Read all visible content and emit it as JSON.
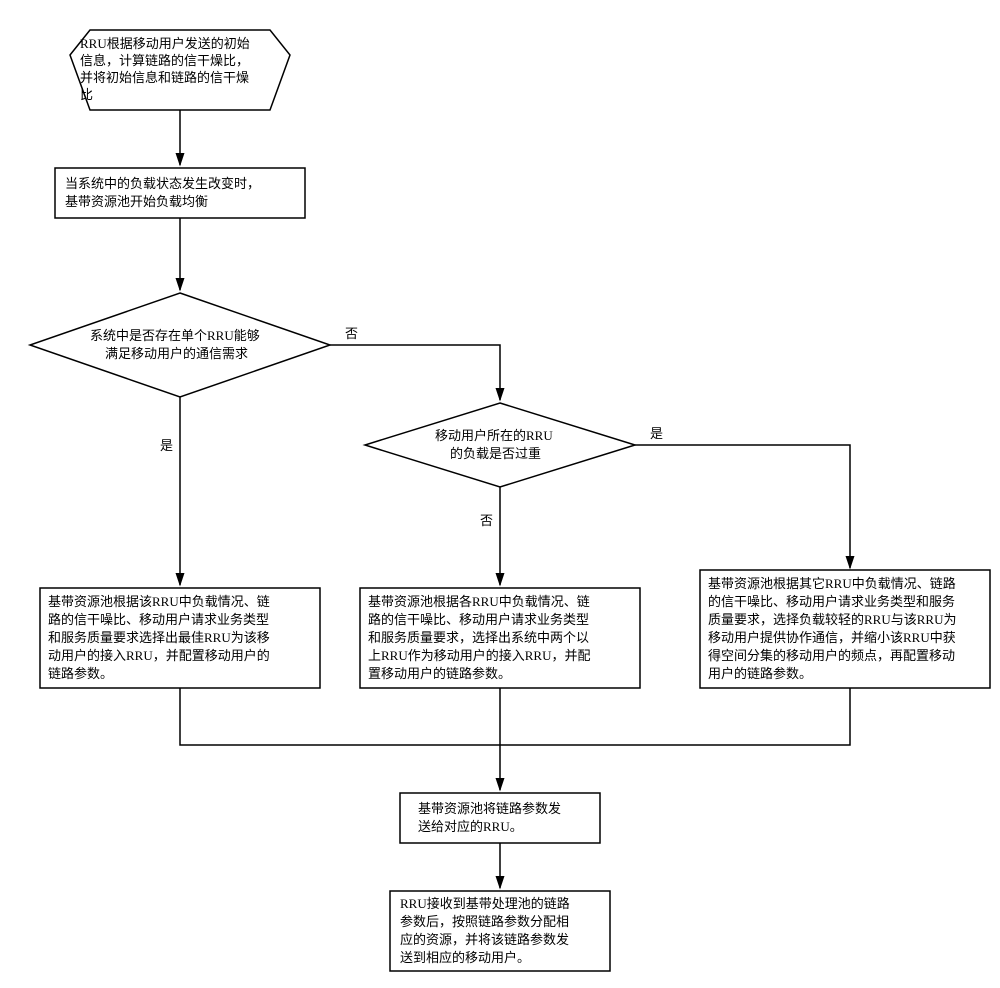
{
  "start": {
    "l1": "RRU根据移动用户发送的初始",
    "l2": "信息，计算链路的信干燥比，",
    "l3": "并将初始信息和链路的信干燥",
    "l4": "比"
  },
  "trigger": {
    "l1": "当系统中的负载状态发生改变时，",
    "l2": "基带资源池开始负载均衡"
  },
  "decision1": {
    "l1": "系统中是否存在单个RRU能够",
    "l2": "满足移动用户的通信需求"
  },
  "decision2": {
    "l1": "移动用户所在的RRU",
    "l2": "的负载是否过重"
  },
  "processA": {
    "l1": "基带资源池根据该RRU中负载情况、链",
    "l2": "路的信干噪比、移动用户请求业务类型",
    "l3": "和服务质量要求选择出最佳RRU为该移",
    "l4": "动用户的接入RRU，并配置移动用户的",
    "l5": "链路参数。"
  },
  "processB": {
    "l1": "基带资源池根据各RRU中负载情况、链",
    "l2": "路的信干噪比、移动用户请求业务类型",
    "l3": "和服务质量要求，选择出系统中两个以",
    "l4": "上RRU作为移动用户的接入RRU，并配",
    "l5": "置移动用户的链路参数。"
  },
  "processC": {
    "l1": "基带资源池根据其它RRU中负载情况、链路",
    "l2": "的信干噪比、移动用户请求业务类型和服务",
    "l3": "质量要求，选择负载较轻的RRU与该RRU为",
    "l4": "移动用户提供协作通信，并缩小该RRU中获",
    "l5": "得空间分集的移动用户的频点，再配置移动",
    "l6": "用户的链路参数。"
  },
  "send": {
    "l1": "基带资源池将链路参数发",
    "l2": "送给对应的RRU。"
  },
  "final": {
    "l1": "RRU接收到基带处理池的链路",
    "l2": "参数后，按照链路参数分配相",
    "l3": "应的资源，并将该链路参数发",
    "l4": "送到相应的移动用户。"
  },
  "labels": {
    "yes": "是",
    "no": "否"
  }
}
